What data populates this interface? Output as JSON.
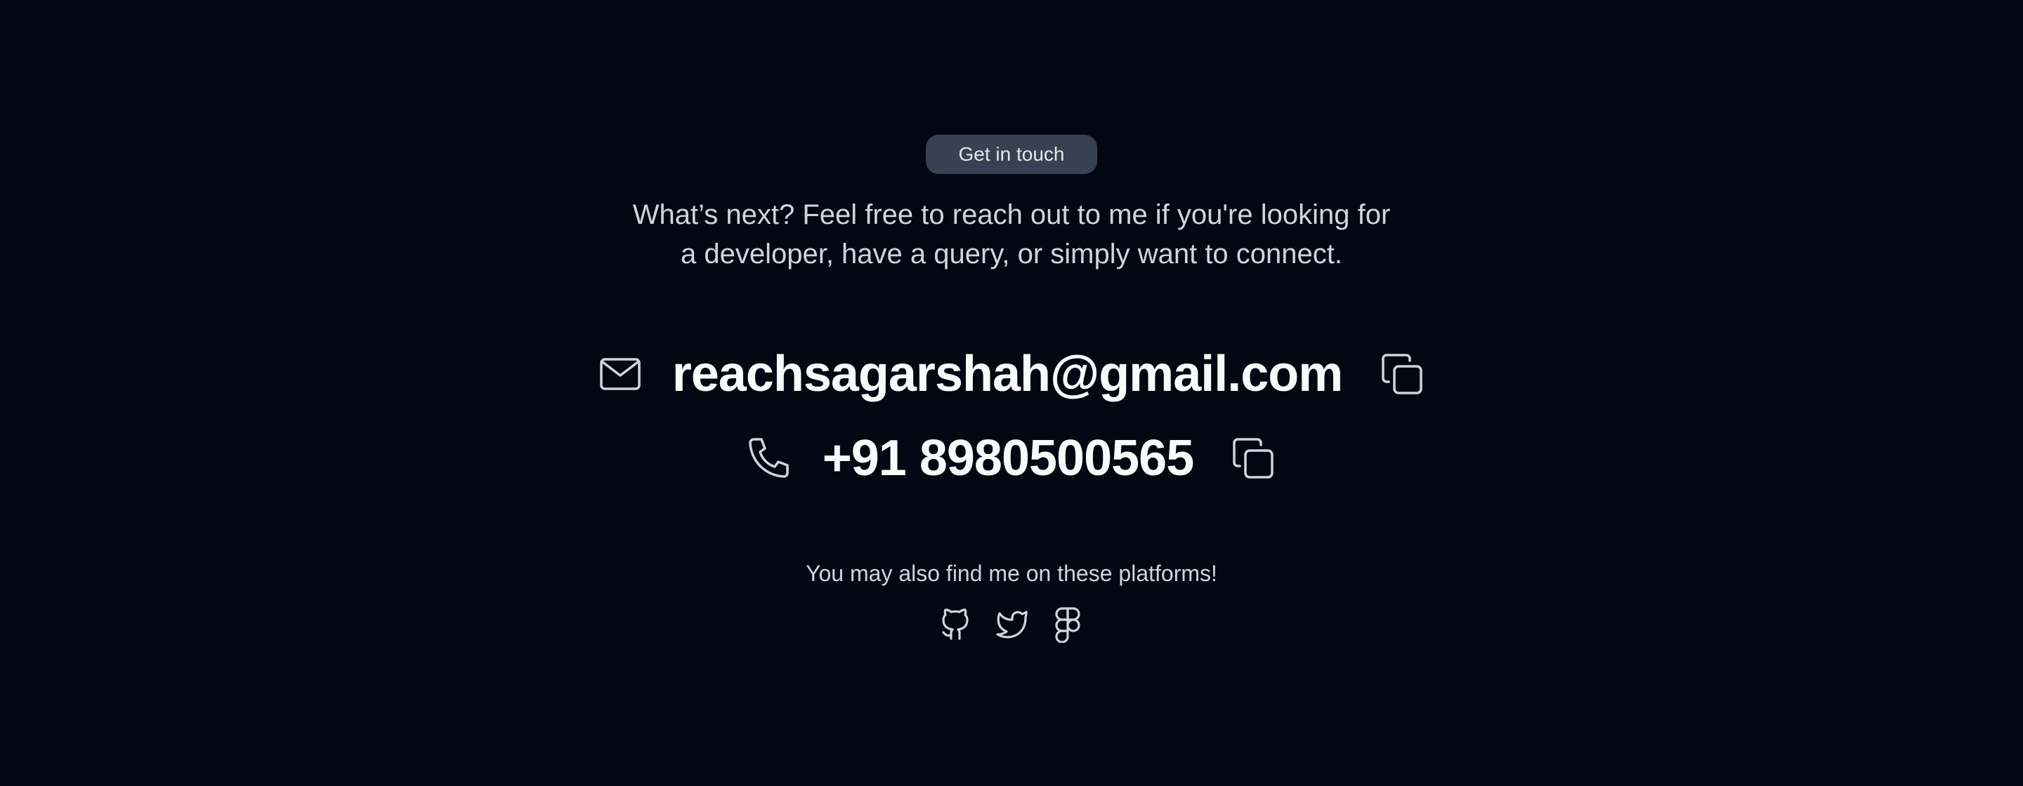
{
  "badge": {
    "label": "Get in touch"
  },
  "intro": {
    "line1": "What’s next? Feel free to reach out to me if you're looking for",
    "line2": "a developer, have a query, or simply want to connect."
  },
  "contact": {
    "email": "reachsagarshah@gmail.com",
    "phone": "+91 8980500565"
  },
  "platforms": {
    "text": "You may also find me on these platforms!",
    "icons": [
      "github-icon",
      "twitter-icon",
      "figma-icon"
    ]
  },
  "colors": {
    "background": "#030712",
    "badge_bg": "#374151",
    "text_primary": "#f9fafb",
    "text_secondary": "#d1d5db",
    "icon": "#d1d5db"
  }
}
